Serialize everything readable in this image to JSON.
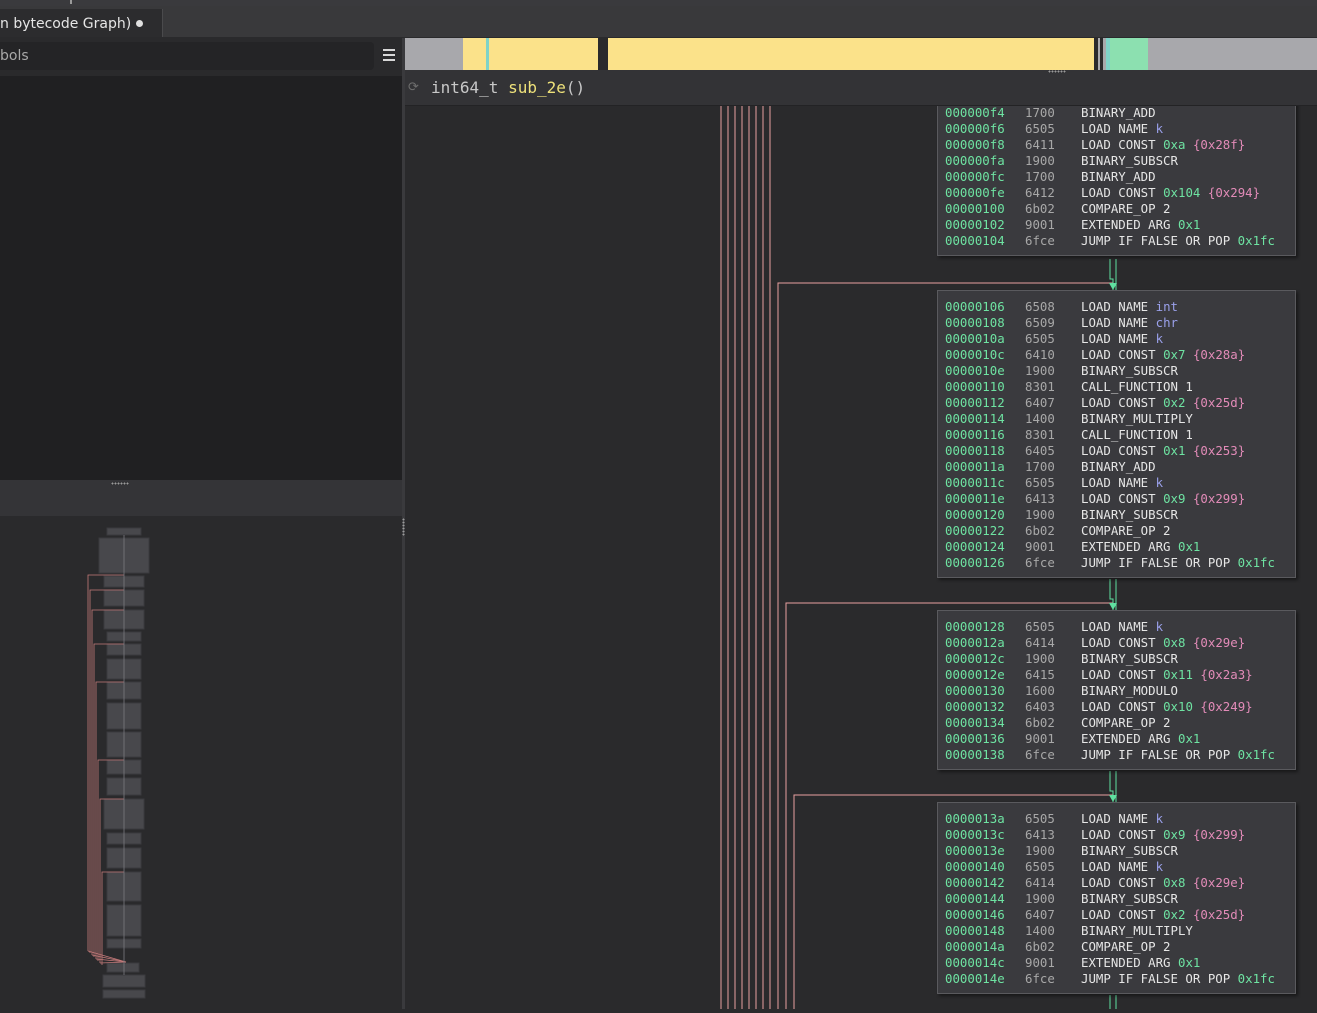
{
  "tab": {
    "title": "n bytecode Graph)"
  },
  "sidebar": {
    "search_placeholder": "bols"
  },
  "header": {
    "type": "int64_t",
    "name": "sub_2e",
    "parens": "()"
  },
  "colors": {
    "address": "#6ee3a2",
    "edge": "#e8a0a0",
    "edge_true": "#5fe0a0",
    "overview_code": "#fbe28a",
    "overview_data": "#8ce0b0"
  },
  "graph": {
    "blocks": [
      {
        "rows": [
          {
            "addr": "000000f4",
            "hex": "1700",
            "op": "BINARY_ADD",
            "arg": "",
            "argk": "",
            "extra": ""
          },
          {
            "addr": "000000f6",
            "hex": "6505",
            "op": "LOAD NAME",
            "arg": "k",
            "argk": "name",
            "extra": ""
          },
          {
            "addr": "000000f8",
            "hex": "6411",
            "op": "LOAD CONST",
            "arg": "0xa",
            "argk": "const",
            "extra": "{0x28f}"
          },
          {
            "addr": "000000fa",
            "hex": "1900",
            "op": "BINARY_SUBSCR",
            "arg": "",
            "argk": "",
            "extra": ""
          },
          {
            "addr": "000000fc",
            "hex": "1700",
            "op": "BINARY_ADD",
            "arg": "",
            "argk": "",
            "extra": ""
          },
          {
            "addr": "000000fe",
            "hex": "6412",
            "op": "LOAD CONST",
            "arg": "0x104",
            "argk": "const",
            "extra": "{0x294}"
          },
          {
            "addr": "00000100",
            "hex": "6b02",
            "op": "COMPARE_OP 2",
            "arg": "",
            "argk": "",
            "extra": ""
          },
          {
            "addr": "00000102",
            "hex": "9001",
            "op": "EXTENDED ARG",
            "arg": "0x1",
            "argk": "const",
            "extra": ""
          },
          {
            "addr": "00000104",
            "hex": "6fce",
            "op": "JUMP IF FALSE OR POP",
            "arg": "0x1fc",
            "argk": "const",
            "extra": ""
          }
        ]
      },
      {
        "rows": [
          {
            "addr": "00000106",
            "hex": "6508",
            "op": "LOAD NAME",
            "arg": "int",
            "argk": "name",
            "extra": ""
          },
          {
            "addr": "00000108",
            "hex": "6509",
            "op": "LOAD NAME",
            "arg": "chr",
            "argk": "name",
            "extra": ""
          },
          {
            "addr": "0000010a",
            "hex": "6505",
            "op": "LOAD NAME",
            "arg": "k",
            "argk": "name",
            "extra": ""
          },
          {
            "addr": "0000010c",
            "hex": "6410",
            "op": "LOAD CONST",
            "arg": "0x7",
            "argk": "const",
            "extra": "{0x28a}"
          },
          {
            "addr": "0000010e",
            "hex": "1900",
            "op": "BINARY_SUBSCR",
            "arg": "",
            "argk": "",
            "extra": ""
          },
          {
            "addr": "00000110",
            "hex": "8301",
            "op": "CALL_FUNCTION 1",
            "arg": "",
            "argk": "",
            "extra": ""
          },
          {
            "addr": "00000112",
            "hex": "6407",
            "op": "LOAD CONST",
            "arg": "0x2",
            "argk": "const",
            "extra": "{0x25d}"
          },
          {
            "addr": "00000114",
            "hex": "1400",
            "op": "BINARY_MULTIPLY",
            "arg": "",
            "argk": "",
            "extra": ""
          },
          {
            "addr": "00000116",
            "hex": "8301",
            "op": "CALL_FUNCTION 1",
            "arg": "",
            "argk": "",
            "extra": ""
          },
          {
            "addr": "00000118",
            "hex": "6405",
            "op": "LOAD CONST",
            "arg": "0x1",
            "argk": "const",
            "extra": "{0x253}"
          },
          {
            "addr": "0000011a",
            "hex": "1700",
            "op": "BINARY_ADD",
            "arg": "",
            "argk": "",
            "extra": ""
          },
          {
            "addr": "0000011c",
            "hex": "6505",
            "op": "LOAD NAME",
            "arg": "k",
            "argk": "name",
            "extra": ""
          },
          {
            "addr": "0000011e",
            "hex": "6413",
            "op": "LOAD CONST",
            "arg": "0x9",
            "argk": "const",
            "extra": "{0x299}"
          },
          {
            "addr": "00000120",
            "hex": "1900",
            "op": "BINARY_SUBSCR",
            "arg": "",
            "argk": "",
            "extra": ""
          },
          {
            "addr": "00000122",
            "hex": "6b02",
            "op": "COMPARE_OP 2",
            "arg": "",
            "argk": "",
            "extra": ""
          },
          {
            "addr": "00000124",
            "hex": "9001",
            "op": "EXTENDED ARG",
            "arg": "0x1",
            "argk": "const",
            "extra": ""
          },
          {
            "addr": "00000126",
            "hex": "6fce",
            "op": "JUMP IF FALSE OR POP",
            "arg": "0x1fc",
            "argk": "const",
            "extra": ""
          }
        ]
      },
      {
        "rows": [
          {
            "addr": "00000128",
            "hex": "6505",
            "op": "LOAD NAME",
            "arg": "k",
            "argk": "name",
            "extra": ""
          },
          {
            "addr": "0000012a",
            "hex": "6414",
            "op": "LOAD CONST",
            "arg": "0x8",
            "argk": "const",
            "extra": "{0x29e}"
          },
          {
            "addr": "0000012c",
            "hex": "1900",
            "op": "BINARY_SUBSCR",
            "arg": "",
            "argk": "",
            "extra": ""
          },
          {
            "addr": "0000012e",
            "hex": "6415",
            "op": "LOAD CONST",
            "arg": "0x11",
            "argk": "const",
            "extra": "{0x2a3}"
          },
          {
            "addr": "00000130",
            "hex": "1600",
            "op": "BINARY_MODULO",
            "arg": "",
            "argk": "",
            "extra": ""
          },
          {
            "addr": "00000132",
            "hex": "6403",
            "op": "LOAD CONST",
            "arg": "0x10",
            "argk": "const",
            "extra": "{0x249}"
          },
          {
            "addr": "00000134",
            "hex": "6b02",
            "op": "COMPARE_OP 2",
            "arg": "",
            "argk": "",
            "extra": ""
          },
          {
            "addr": "00000136",
            "hex": "9001",
            "op": "EXTENDED ARG",
            "arg": "0x1",
            "argk": "const",
            "extra": ""
          },
          {
            "addr": "00000138",
            "hex": "6fce",
            "op": "JUMP IF FALSE OR POP",
            "arg": "0x1fc",
            "argk": "const",
            "extra": ""
          }
        ]
      },
      {
        "rows": [
          {
            "addr": "0000013a",
            "hex": "6505",
            "op": "LOAD NAME",
            "arg": "k",
            "argk": "name",
            "extra": ""
          },
          {
            "addr": "0000013c",
            "hex": "6413",
            "op": "LOAD CONST",
            "arg": "0x9",
            "argk": "const",
            "extra": "{0x299}"
          },
          {
            "addr": "0000013e",
            "hex": "1900",
            "op": "BINARY_SUBSCR",
            "arg": "",
            "argk": "",
            "extra": ""
          },
          {
            "addr": "00000140",
            "hex": "6505",
            "op": "LOAD NAME",
            "arg": "k",
            "argk": "name",
            "extra": ""
          },
          {
            "addr": "00000142",
            "hex": "6414",
            "op": "LOAD CONST",
            "arg": "0x8",
            "argk": "const",
            "extra": "{0x29e}"
          },
          {
            "addr": "00000144",
            "hex": "1900",
            "op": "BINARY_SUBSCR",
            "arg": "",
            "argk": "",
            "extra": ""
          },
          {
            "addr": "00000146",
            "hex": "6407",
            "op": "LOAD CONST",
            "arg": "0x2",
            "argk": "const",
            "extra": "{0x25d}"
          },
          {
            "addr": "00000148",
            "hex": "1400",
            "op": "BINARY_MULTIPLY",
            "arg": "",
            "argk": "",
            "extra": ""
          },
          {
            "addr": "0000014a",
            "hex": "6b02",
            "op": "COMPARE_OP 2",
            "arg": "",
            "argk": "",
            "extra": ""
          },
          {
            "addr": "0000014c",
            "hex": "9001",
            "op": "EXTENDED ARG",
            "arg": "0x1",
            "argk": "const",
            "extra": ""
          },
          {
            "addr": "0000014e",
            "hex": "6fce",
            "op": "JUMP IF FALSE OR POP",
            "arg": "0x1fc",
            "argk": "const",
            "extra": ""
          }
        ]
      }
    ]
  }
}
